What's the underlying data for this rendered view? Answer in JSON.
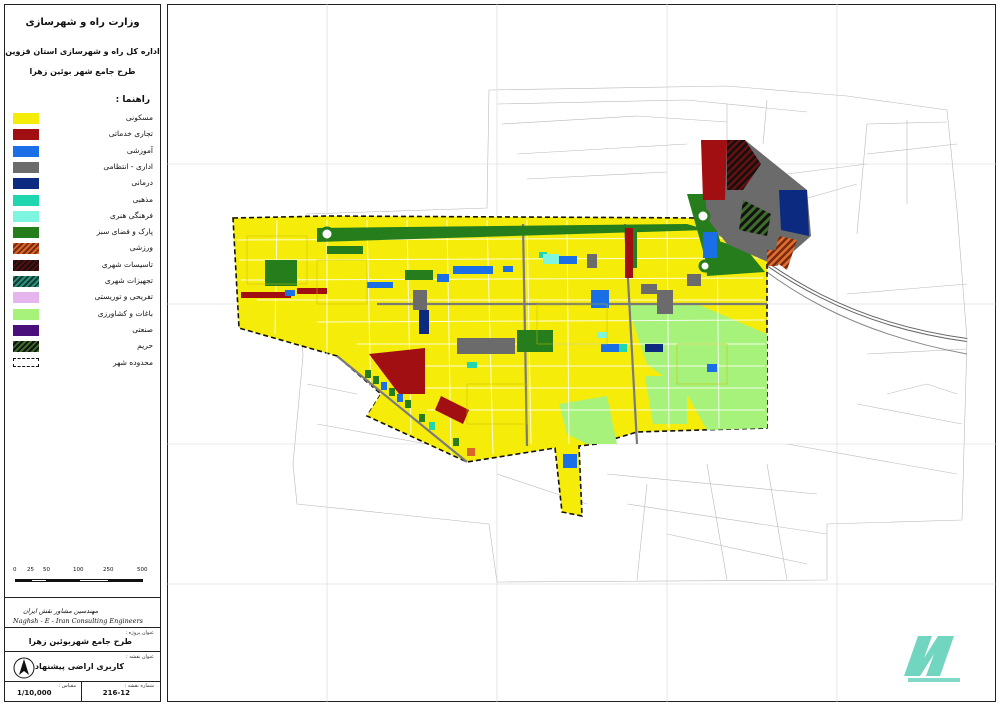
{
  "header": {
    "ministry": "وزارت راه و شهرسازی",
    "office": "اداره کل راه و شهرسازی استان قزوین",
    "project": "طرح جامع شهر بوئین زهرا"
  },
  "legend": {
    "title": "راهنما :",
    "items": [
      {
        "label": "مسکونی",
        "color": "#f5ec0a",
        "pattern": "solid"
      },
      {
        "label": "تجاری خدماتی",
        "color": "#a10f13",
        "pattern": "solid"
      },
      {
        "label": "آموزشی",
        "color": "#1a6ee6",
        "pattern": "solid"
      },
      {
        "label": "اداری - انتظامی",
        "color": "#6b6b6b",
        "pattern": "solid"
      },
      {
        "label": "درمانی",
        "color": "#0b2a80",
        "pattern": "solid"
      },
      {
        "label": "مذهبی",
        "color": "#1fd6b0",
        "pattern": "solid"
      },
      {
        "label": "فرهنگی هنری",
        "color": "#7ef5de",
        "pattern": "solid"
      },
      {
        "label": "پارک و فضای سبز",
        "color": "#267d1c",
        "pattern": "solid"
      },
      {
        "label": "ورزشی",
        "color": "#d9652a",
        "pattern": "hatch-or"
      },
      {
        "label": "تاسیسات شهری",
        "color": "#5a0b0b",
        "pattern": "hatch-dk"
      },
      {
        "label": "تجهیزات شهری",
        "color": "#2f8f7a",
        "pattern": "hatch-te"
      },
      {
        "label": "تفریحی و توریستی",
        "color": "#e6b5f0",
        "pattern": "solid"
      },
      {
        "label": "باغات و کشاورزی",
        "color": "#a6f27a",
        "pattern": "solid"
      },
      {
        "label": "صنعتی",
        "color": "#4a0f7a",
        "pattern": "solid"
      },
      {
        "label": "حریم",
        "color": "#3d6b2a",
        "pattern": "hatch-gr"
      },
      {
        "label": "محدوده شهر",
        "color": "#111111",
        "pattern": "dash"
      }
    ]
  },
  "scale": {
    "labels": [
      "0",
      "25",
      "50",
      "100",
      "250",
      "500"
    ]
  },
  "title_block": {
    "consultant_fa": "مهندسین مشاور نقش ایران",
    "consultant_en": "Naghsh - E - Iran Consulting Engineers",
    "project_caption": "عنوان پروژه :",
    "project_name": "طرح جامع شهربوئین زهرا",
    "map_caption": "عنوان نقشه :",
    "map_title": "کاربری اراضی پیشنهادی",
    "scale_caption": "مقیاس :",
    "scale_value": "1/10,000",
    "sheet_caption": "شماره نقشه :",
    "sheet_number": "216-12"
  },
  "icons": {
    "north": "north-arrow-icon",
    "logo": "publisher-logo"
  }
}
